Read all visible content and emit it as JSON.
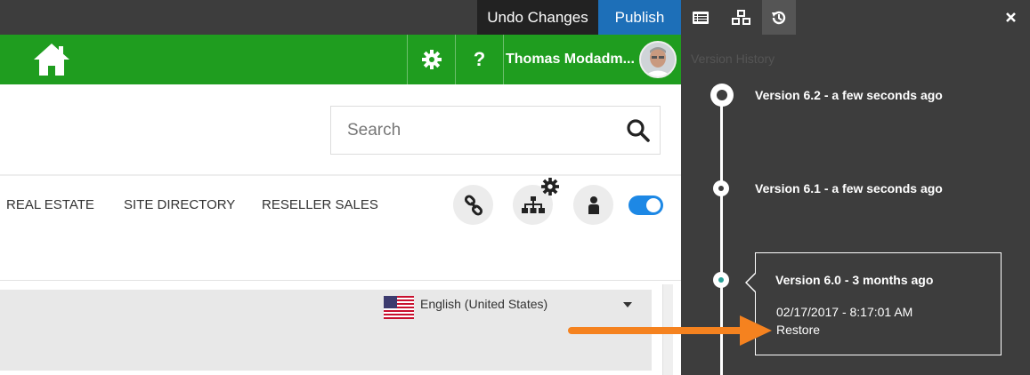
{
  "toolbar": {
    "undo_label": "Undo Changes",
    "publish_label": "Publish",
    "icons": [
      "list-icon",
      "boxes-icon",
      "history-icon",
      "close-icon"
    ]
  },
  "header": {
    "user_name": "Thomas Modadm...",
    "help_label": "?",
    "icons": [
      "home-icon",
      "gear-icon",
      "help-icon"
    ]
  },
  "search": {
    "placeholder": "Search"
  },
  "nav": {
    "items": [
      {
        "label": "REAL ESTATE"
      },
      {
        "label": "SITE DIRECTORY"
      },
      {
        "label": "RESELLER SALES"
      }
    ],
    "action_icons": [
      "link-icon",
      "sitemap-icon",
      "user-icon"
    ]
  },
  "language": {
    "selected": "English (United States)"
  },
  "version_history": {
    "title": "Version History",
    "versions": [
      {
        "label": "Version 6.2 - a few seconds ago"
      },
      {
        "label": "Version 6.1 - a few seconds ago"
      },
      {
        "label": "Version 6.0 - 3 months ago"
      }
    ],
    "popup": {
      "title": "Version 6.0 - 3 months ago",
      "date": "02/17/2017 - 8:17:01 AM",
      "restore_label": "Restore"
    }
  },
  "colors": {
    "topbar": "#3d3d3d",
    "publish": "#1d6fb8",
    "green_header": "#1f9d1f",
    "panel_bg": "#3d3d3d",
    "arrow": "#f5821f",
    "toggle": "#1d88e5"
  }
}
